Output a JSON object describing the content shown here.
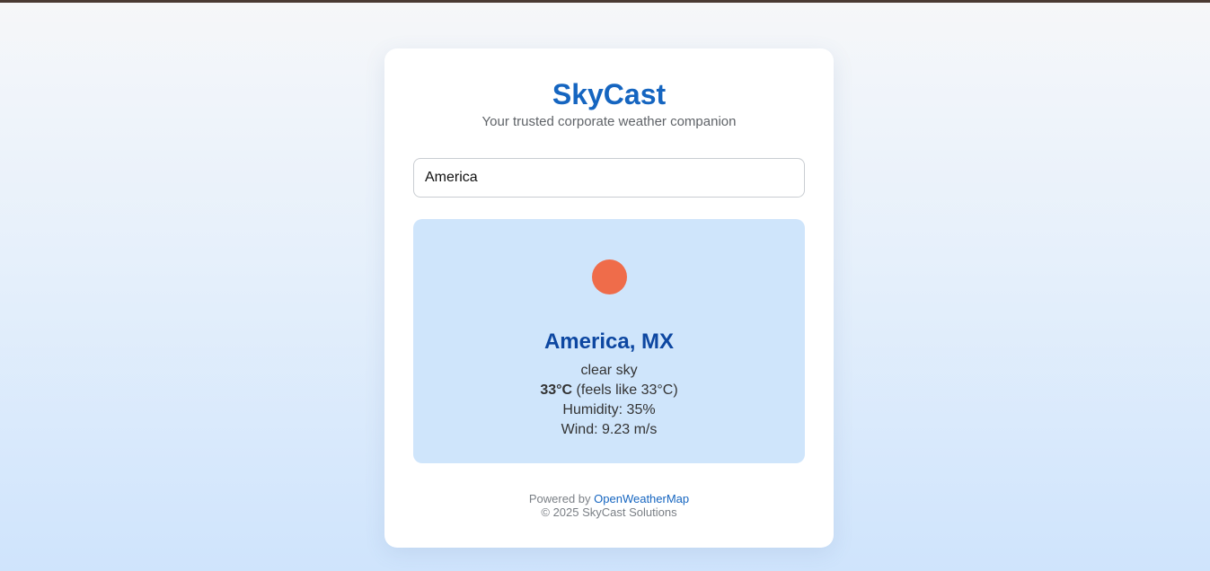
{
  "header": {
    "title": "SkyCast",
    "tagline": "Your trusted corporate weather companion"
  },
  "search": {
    "value": "America"
  },
  "weather": {
    "icon": "sun-icon",
    "icon_color": "#ef6c4a",
    "location": "America, MX",
    "description": "clear sky",
    "temperature": "33°C",
    "feels_like": "(feels like 33°C)",
    "humidity": "Humidity: 35%",
    "wind": "Wind: 9.23 m/s"
  },
  "footer": {
    "powered_by_prefix": "Powered by",
    "powered_by_link": "OpenWeatherMap",
    "copyright": "© 2025 SkyCast Solutions"
  },
  "colors": {
    "brand": "#1565c0",
    "location": "#0d47a1",
    "panel": "#cfe5fb",
    "top_border": "#4a3a33"
  }
}
